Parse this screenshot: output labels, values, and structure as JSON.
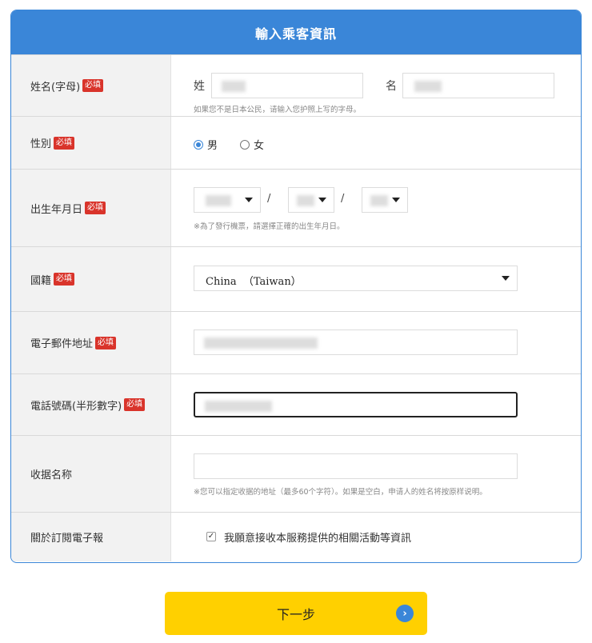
{
  "form": {
    "title": "輸入乘客資訊",
    "required_tag": "必填",
    "name": {
      "label": "姓名(字母)",
      "surname_label": "姓",
      "given_label": "名",
      "note": "如果您不是日本公民，请输入您护照上写的字母。"
    },
    "gender": {
      "label": "性別",
      "options": [
        "男",
        "女"
      ],
      "selected": "男"
    },
    "birthdate": {
      "label": "出生年月日",
      "separator": "/",
      "note": "※為了發行機票，請選擇正確的出生年月日。"
    },
    "nationality": {
      "label": "國籍",
      "selected": "China  （Taiwan）"
    },
    "email": {
      "label": "電子郵件地址"
    },
    "phone": {
      "label": "電話號碼(半形數字)"
    },
    "receipt": {
      "label": "收据名称",
      "note": "※您可以指定收据的地址（最多60个字符）。如果是空白，申请人的姓名将按原样说明。"
    },
    "newsletter": {
      "label": "關於訂閱電子報",
      "checkbox_label": "我願意接收本服務提供的相關活動等資訊",
      "checked": true
    }
  },
  "next_button": {
    "label": "下一步",
    "icon": "chevron-right-circle-icon"
  },
  "colors": {
    "accent": "#3a86d8",
    "required": "#d9342b",
    "button": "#ffd000"
  }
}
